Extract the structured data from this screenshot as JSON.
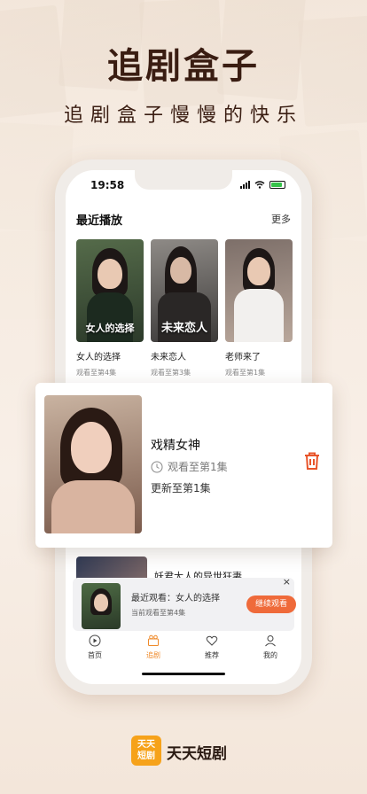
{
  "hero": {
    "title": "追剧盒子",
    "subtitle": "追剧盒子慢慢的快乐"
  },
  "status_bar": {
    "time": "19:58"
  },
  "recent": {
    "title": "最近播放",
    "more": "更多",
    "items": [
      {
        "title": "女人的选择",
        "progress": "观看至第4集",
        "poster_caption": "女人的选择"
      },
      {
        "title": "未来恋人",
        "progress": "观看至第3集",
        "poster_caption": "未来恋人"
      },
      {
        "title": "老师来了",
        "progress": "观看至第1集",
        "poster_caption": ""
      }
    ]
  },
  "highlight_card": {
    "title": "戏精女神",
    "progress": "观看至第1集",
    "update": "更新至第1集",
    "delete_icon": "trash-icon",
    "accent": "#e8542a"
  },
  "list_item": {
    "title": "妖君大人的异世狂妻"
  },
  "resume_bar": {
    "recent_label": "最近观看：女人的选择",
    "current_label": "当前观看至第4集",
    "button": "继续观看",
    "close": "×",
    "accent": "#ef6a3a"
  },
  "tabs": [
    {
      "label": "首页",
      "icon": "play-icon",
      "active": false
    },
    {
      "label": "追剧",
      "icon": "video-icon",
      "active": true
    },
    {
      "label": "推荐",
      "icon": "heart-icon",
      "active": false
    },
    {
      "label": "我的",
      "icon": "user-icon",
      "active": false
    }
  ],
  "brand": {
    "logo_text": "天天短剧",
    "name": "天天短剧",
    "color": "#f6a21a"
  }
}
